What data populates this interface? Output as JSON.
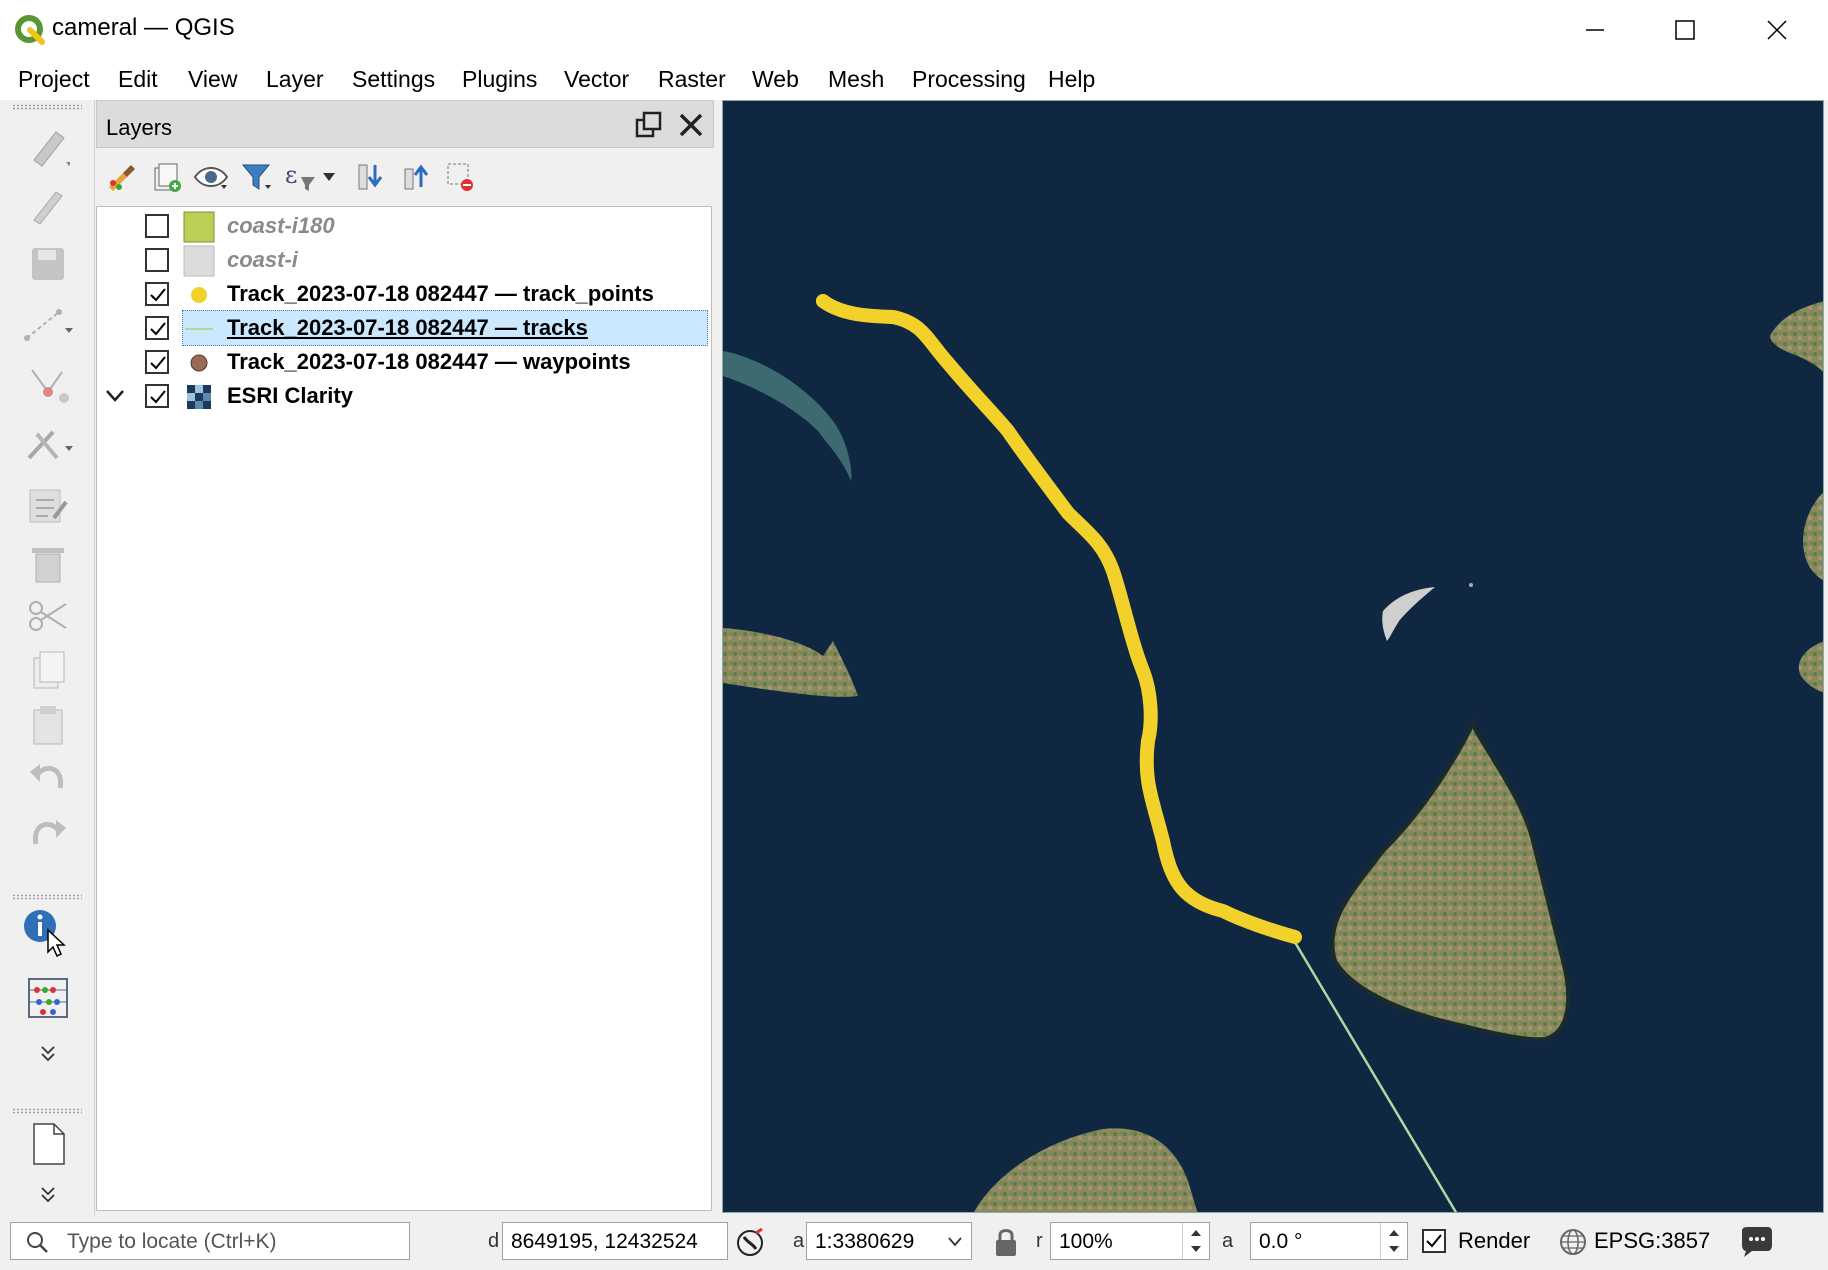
{
  "window": {
    "title": "cameral — QGIS",
    "controls": [
      "minimize",
      "maximize",
      "close"
    ]
  },
  "menu": [
    "Project",
    "Edit",
    "View",
    "Layer",
    "Settings",
    "Plugins",
    "Vector",
    "Raster",
    "Web",
    "Mesh",
    "Processing",
    "Help"
  ],
  "layers_panel": {
    "title": "Layers",
    "toolbar_icons": [
      "style-brush-icon",
      "add-group-icon",
      "visibility-eye-icon",
      "filter-funnel-icon",
      "expression-filter-icon",
      "expand-all-icon",
      "collapse-all-icon",
      "remove-layer-icon"
    ],
    "layers": [
      {
        "name": "coast-i180",
        "checked": false,
        "symbol": "fill",
        "color": "#b9cf55"
      },
      {
        "name": "coast-i",
        "checked": false,
        "symbol": "fill",
        "color": "#dcdcdc"
      },
      {
        "name": "Track_2023-07-18 082447 — track_points",
        "checked": true,
        "symbol": "point",
        "color": "#f2d12a"
      },
      {
        "name": "Track_2023-07-18 082447 — tracks",
        "checked": true,
        "symbol": "line",
        "color": "#a8dba0",
        "selected": true
      },
      {
        "name": "Track_2023-07-18 082447 — waypoints",
        "checked": true,
        "symbol": "point",
        "color": "#9b6a55"
      },
      {
        "name": "ESRI Clarity",
        "checked": true,
        "symbol": "raster",
        "expanded": true
      }
    ]
  },
  "status": {
    "locator_placeholder": "Type to locate (Ctrl+K)",
    "coord_label": "d",
    "coordinate": "8649195, 12432524",
    "scale_label": "a",
    "scale": "1:3380629",
    "magnifier_label": "r",
    "magnifier": "100%",
    "rotation_label": "a",
    "rotation": "0.0 °",
    "render_label": "Render",
    "render_checked": true,
    "crs": "EPSG:3857"
  },
  "colors": {
    "sea": "#0f2740",
    "track_points": "#f2d12a",
    "track_line": "#a8dba0",
    "selection": "#cce8ff"
  }
}
